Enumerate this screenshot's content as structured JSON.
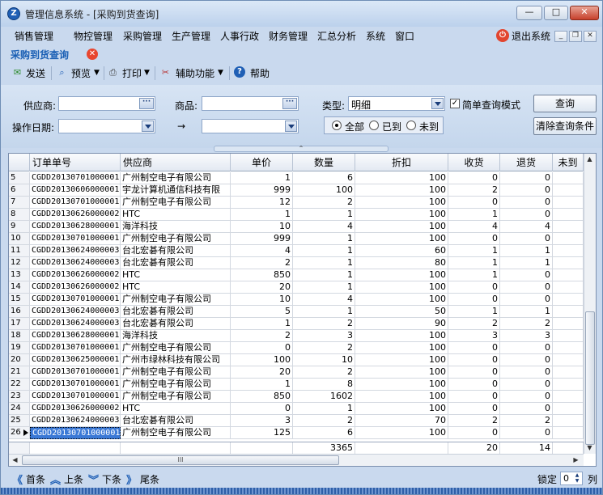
{
  "window": {
    "title": "管理信息系统 - [采购到货查询]",
    "controls": [
      "—",
      "□",
      "✕"
    ]
  },
  "menu": {
    "items": [
      "销售管理",
      "物控管理",
      "采购管理",
      "生产管理",
      "人事行政",
      "财务管理",
      "汇总分析",
      "系统",
      "窗口"
    ],
    "exit_label": "退出系统"
  },
  "document": {
    "title": "采购到货查询"
  },
  "toolbar": {
    "send": "发送",
    "preview": "预览",
    "print": "打印",
    "assist": "辅助功能",
    "help": "帮助"
  },
  "filters": {
    "supplier_label": "供应商:",
    "product_label": "商品:",
    "type_label": "类型:",
    "type_value": "明细",
    "simple_mode_label": "简单查询模式",
    "simple_mode_checked": "✓",
    "date_label": "操作日期:",
    "date_arrow": "→",
    "radio_all": "全部",
    "radio_arrived": "已到",
    "radio_not_arrived": "未到",
    "query_button": "查询",
    "clear_button": "清除查询条件"
  },
  "grid": {
    "columns": [
      "订单单号",
      "供应商",
      "单价",
      "数量",
      "折扣",
      "收货",
      "退货",
      "未到"
    ],
    "rows": [
      {
        "n": "5",
        "order": "CGDD20130701000001",
        "supplier": "广州制空电子有限公司",
        "price": "1",
        "qty": "6",
        "discount": "100",
        "received": "0",
        "returned": "0"
      },
      {
        "n": "6",
        "order": "CGDD20130606000001",
        "supplier": "宇龙计算机通信科技有限",
        "price": "999",
        "qty": "100",
        "discount": "100",
        "received": "2",
        "returned": "0"
      },
      {
        "n": "7",
        "order": "CGDD20130701000001",
        "supplier": "广州制空电子有限公司",
        "price": "12",
        "qty": "2",
        "discount": "100",
        "received": "0",
        "returned": "0"
      },
      {
        "n": "8",
        "order": "CGDD20130626000002",
        "supplier": "HTC",
        "price": "1",
        "qty": "1",
        "discount": "100",
        "received": "1",
        "returned": "0"
      },
      {
        "n": "9",
        "order": "CGDD20130628000001",
        "supplier": "海洋科技",
        "price": "10",
        "qty": "4",
        "discount": "100",
        "received": "4",
        "returned": "4"
      },
      {
        "n": "10",
        "order": "CGDD20130701000001",
        "supplier": "广州制空电子有限公司",
        "price": "999",
        "qty": "1",
        "discount": "100",
        "received": "0",
        "returned": "0"
      },
      {
        "n": "11",
        "order": "CGDD20130624000003",
        "supplier": "台北宏碁有限公司",
        "price": "4",
        "qty": "1",
        "discount": "60",
        "received": "1",
        "returned": "1"
      },
      {
        "n": "12",
        "order": "CGDD20130624000003",
        "supplier": "台北宏碁有限公司",
        "price": "2",
        "qty": "1",
        "discount": "80",
        "received": "1",
        "returned": "1"
      },
      {
        "n": "13",
        "order": "CGDD20130626000002",
        "supplier": "HTC",
        "price": "850",
        "qty": "1",
        "discount": "100",
        "received": "1",
        "returned": "0"
      },
      {
        "n": "14",
        "order": "CGDD20130626000002",
        "supplier": "HTC",
        "price": "20",
        "qty": "1",
        "discount": "100",
        "received": "0",
        "returned": "0"
      },
      {
        "n": "15",
        "order": "CGDD20130701000001",
        "supplier": "广州制空电子有限公司",
        "price": "10",
        "qty": "4",
        "discount": "100",
        "received": "0",
        "returned": "0"
      },
      {
        "n": "16",
        "order": "CGDD20130624000003",
        "supplier": "台北宏碁有限公司",
        "price": "5",
        "qty": "1",
        "discount": "50",
        "received": "1",
        "returned": "1"
      },
      {
        "n": "17",
        "order": "CGDD20130624000003",
        "supplier": "台北宏碁有限公司",
        "price": "1",
        "qty": "2",
        "discount": "90",
        "received": "2",
        "returned": "2"
      },
      {
        "n": "18",
        "order": "CGDD20130628000001",
        "supplier": "海洋科技",
        "price": "2",
        "qty": "3",
        "discount": "100",
        "received": "3",
        "returned": "3"
      },
      {
        "n": "19",
        "order": "CGDD20130701000001",
        "supplier": "广州制空电子有限公司",
        "price": "0",
        "qty": "2",
        "discount": "100",
        "received": "0",
        "returned": "0"
      },
      {
        "n": "20",
        "order": "CGDD20130625000001",
        "supplier": "广州市绿林科技有限公司",
        "price": "100",
        "qty": "10",
        "discount": "100",
        "received": "0",
        "returned": "0"
      },
      {
        "n": "21",
        "order": "CGDD20130701000001",
        "supplier": "广州制空电子有限公司",
        "price": "20",
        "qty": "2",
        "discount": "100",
        "received": "0",
        "returned": "0"
      },
      {
        "n": "22",
        "order": "CGDD20130701000001",
        "supplier": "广州制空电子有限公司",
        "price": "1",
        "qty": "8",
        "discount": "100",
        "received": "0",
        "returned": "0"
      },
      {
        "n": "23",
        "order": "CGDD20130701000001",
        "supplier": "广州制空电子有限公司",
        "price": "850",
        "qty": "1602",
        "discount": "100",
        "received": "0",
        "returned": "0"
      },
      {
        "n": "24",
        "order": "CGDD20130626000002",
        "supplier": "HTC",
        "price": "0",
        "qty": "1",
        "discount": "100",
        "received": "0",
        "returned": "0"
      },
      {
        "n": "25",
        "order": "CGDD20130624000003",
        "supplier": "台北宏碁有限公司",
        "price": "3",
        "qty": "2",
        "discount": "70",
        "received": "2",
        "returned": "2"
      },
      {
        "n": "26",
        "order": "CGDD20130701000001",
        "supplier": "广州制空电子有限公司",
        "price": "125",
        "qty": "6",
        "discount": "100",
        "received": "0",
        "returned": "0"
      }
    ],
    "totals": {
      "qty": "3365",
      "received": "20",
      "returned": "14"
    },
    "hscroll_grip": "III"
  },
  "nav": {
    "first": "首条",
    "prev": "上条",
    "next": "下条",
    "last": "尾条",
    "lock_label": "锁定",
    "lock_value": "0",
    "col_label": "列"
  }
}
